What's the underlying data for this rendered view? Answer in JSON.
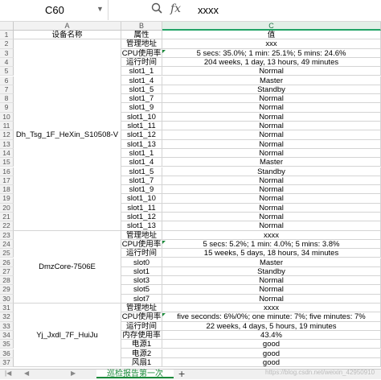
{
  "toolbar": {
    "name_box": "C60",
    "formula_value": "xxxx",
    "zoom_icon": "zoom-icon",
    "fx_label": "fx"
  },
  "columns": [
    "A",
    "B",
    "C"
  ],
  "rows": [
    {
      "n": "1",
      "b": "属性",
      "c": "值"
    },
    {
      "n": "2",
      "b": "管理地址",
      "c": "xxx"
    },
    {
      "n": "3",
      "b": "CPU使用率",
      "c": "5 secs: 35.0%; 1 min: 25.1%; 5 mins: 24.6%"
    },
    {
      "n": "4",
      "b": "运行时间",
      "c": "204 weeks, 1 day, 13 hours, 49 minutes"
    },
    {
      "n": "5",
      "b": "slot1_1",
      "c": "Normal"
    },
    {
      "n": "6",
      "b": "slot1_4",
      "c": "Master"
    },
    {
      "n": "7",
      "b": "slot1_5",
      "c": "Standby"
    },
    {
      "n": "8",
      "b": "slot1_7",
      "c": "Normal"
    },
    {
      "n": "9",
      "b": "slot1_9",
      "c": "Normal"
    },
    {
      "n": "10",
      "b": "slot1_10",
      "c": "Normal"
    },
    {
      "n": "11",
      "b": "slot1_11",
      "c": "Normal"
    },
    {
      "n": "12",
      "b": "slot1_12",
      "c": "Normal"
    },
    {
      "n": "13",
      "b": "slot1_13",
      "c": "Normal"
    },
    {
      "n": "14",
      "b": "slot1_1",
      "c": "Normal"
    },
    {
      "n": "15",
      "b": "slot1_4",
      "c": "Master"
    },
    {
      "n": "16",
      "b": "slot1_5",
      "c": "Standby"
    },
    {
      "n": "17",
      "b": "slot1_7",
      "c": "Normal"
    },
    {
      "n": "18",
      "b": "slot1_9",
      "c": "Normal"
    },
    {
      "n": "19",
      "b": "slot1_10",
      "c": "Normal"
    },
    {
      "n": "20",
      "b": "slot1_11",
      "c": "Normal"
    },
    {
      "n": "21",
      "b": "slot1_12",
      "c": "Normal"
    },
    {
      "n": "22",
      "b": "slot1_13",
      "c": "Normal"
    },
    {
      "n": "23",
      "b": "管理地址",
      "c": "xxxx"
    },
    {
      "n": "24",
      "b": "CPU使用率",
      "c": "5 secs: 5.2%; 1 min: 4.0%; 5 mins: 3.8%"
    },
    {
      "n": "25",
      "b": "运行时间",
      "c": "15 weeks, 5 days, 18 hours, 34 minutes"
    },
    {
      "n": "26",
      "b": "slot0",
      "c": "Master"
    },
    {
      "n": "27",
      "b": "slot1",
      "c": "Standby"
    },
    {
      "n": "28",
      "b": "slot3",
      "c": "Normal"
    },
    {
      "n": "29",
      "b": "slot5",
      "c": "Normal"
    },
    {
      "n": "30",
      "b": "slot7",
      "c": "Normal"
    },
    {
      "n": "31",
      "b": "管理地址",
      "c": "xxxx"
    },
    {
      "n": "32",
      "b": "CPU使用率",
      "c": "five seconds: 6%/0%; one minute: 7%; five minutes: 7%"
    },
    {
      "n": "33",
      "b": "运行时间",
      "c": "22 weeks, 4 days, 5 hours, 19 minutes"
    },
    {
      "n": "34",
      "b": "内存使用率",
      "c": "43.4%"
    },
    {
      "n": "35",
      "b": "电源1",
      "c": "good"
    },
    {
      "n": "36",
      "b": "电源2",
      "c": "good"
    },
    {
      "n": "37",
      "b": "风扇1",
      "c": "good"
    }
  ],
  "header_a": "设备名称",
  "groups": [
    {
      "name": "Dh_Tsg_1F_HeXin_S10508-V",
      "from": 2,
      "to": 22
    },
    {
      "name": "DmzCore-7506E",
      "from": 23,
      "to": 30
    },
    {
      "name": "Yj_Jxdl_7F_HuiJu",
      "from": 31,
      "to": 37
    }
  ],
  "sheet_tab": "巡检报告第一次",
  "watermark": "https://blog.csdn.net/weixin_42950910"
}
